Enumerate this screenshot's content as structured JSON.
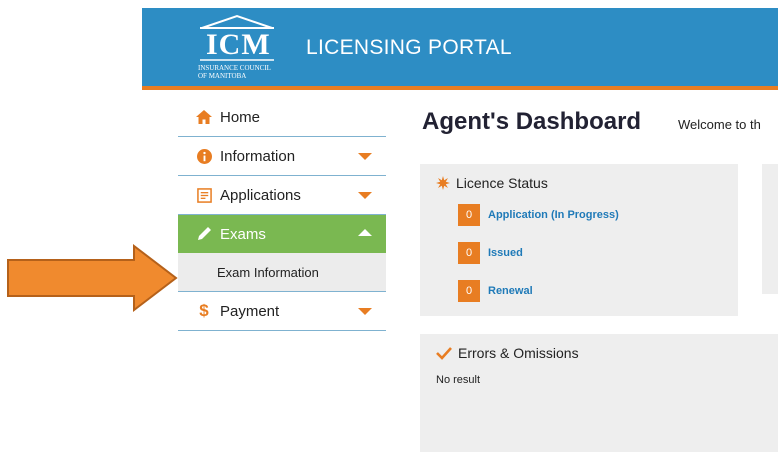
{
  "header": {
    "logo_text": "ICM",
    "logo_subtext": [
      "Insurance Council",
      "of Manitoba"
    ],
    "title": "LICENSING PORTAL"
  },
  "sidebar": {
    "items": [
      {
        "label": "Home",
        "icon": "home-icon"
      },
      {
        "label": "Information",
        "icon": "info-icon"
      },
      {
        "label": "Applications",
        "icon": "applications-icon"
      },
      {
        "label": "Exams",
        "icon": "pencil-icon",
        "active": true
      },
      {
        "label": "Payment",
        "icon": "dollar-icon"
      }
    ],
    "exams_sub": "Exam Information"
  },
  "main": {
    "title": "Agent's Dashboard",
    "welcome": "Welcome to th"
  },
  "licence_status": {
    "title": "Licence Status",
    "rows": [
      {
        "count": "0",
        "label": "Application (In Progress)"
      },
      {
        "count": "0",
        "label": "Issued"
      },
      {
        "count": "0",
        "label": "Renewal"
      }
    ]
  },
  "errors_omissions": {
    "title": "Errors & Omissions",
    "text": "No result"
  },
  "colors": {
    "header_blue": "#2d8dc4",
    "accent_orange": "#e87d22",
    "active_green": "#7ab851",
    "link_blue": "#1f7ab8"
  }
}
